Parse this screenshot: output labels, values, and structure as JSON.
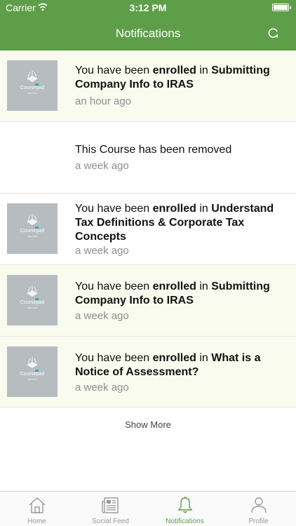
{
  "status": {
    "carrier": "Carrier",
    "time": "3:12 PM"
  },
  "header": {
    "title": "Notifications"
  },
  "notifications": [
    {
      "prefix": "You have been",
      "verb": "enrolled",
      "mid": "in",
      "course": "Submitting Company Info to IRAS",
      "time": "an hour ago"
    },
    {
      "message": "This Course has been removed",
      "time": "a week ago"
    },
    {
      "prefix": "You have been",
      "verb": "enrolled",
      "mid": "in",
      "course": "Understand Tax Definitions & Corporate Tax Concepts",
      "time": "a week ago"
    },
    {
      "prefix": "You have been",
      "verb": "enrolled",
      "mid": "in",
      "course": "Submitting Company Info to IRAS",
      "time": "a week ago"
    },
    {
      "prefix": "You have been",
      "verb": "enrolled",
      "mid": "in",
      "course": "What is a Notice of Assessment?",
      "time": "a week ago"
    }
  ],
  "thumbnail": {
    "brand": "Coursepad",
    "subtitle": "NEXTCAS"
  },
  "show_more": "Show More",
  "tabs": [
    {
      "label": "Home",
      "icon": "home-icon",
      "active": false
    },
    {
      "label": "Social Feed",
      "icon": "newspaper-icon",
      "active": false
    },
    {
      "label": "Notifications",
      "icon": "bell-icon",
      "active": true
    },
    {
      "label": "Profile",
      "icon": "person-icon",
      "active": false
    }
  ],
  "colors": {
    "brand": "#5e9e48",
    "unread_bg": "#f9fbef",
    "inactive_tab": "#999999"
  }
}
